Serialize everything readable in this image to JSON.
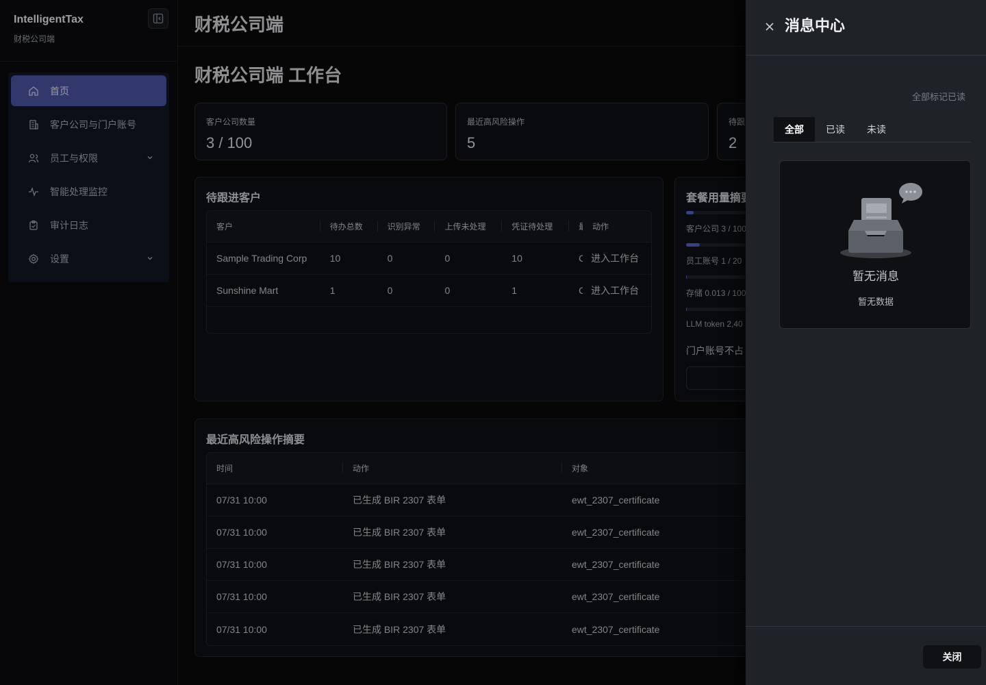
{
  "brand": {
    "title": "IntelligentTax",
    "subtitle": "财税公司端"
  },
  "nav": [
    {
      "label": "首页",
      "icon": "home-icon",
      "active": true
    },
    {
      "label": "客户公司与门户账号",
      "icon": "building-icon"
    },
    {
      "label": "员工与权限",
      "icon": "users-icon",
      "expandable": true
    },
    {
      "label": "智能处理监控",
      "icon": "activity-icon"
    },
    {
      "label": "审计日志",
      "icon": "clipboard-icon"
    },
    {
      "label": "设置",
      "icon": "gear-icon",
      "expandable": true
    }
  ],
  "header": {
    "title": "财税公司端"
  },
  "page": {
    "title": "财税公司端 工作台"
  },
  "stats": [
    {
      "label": "客户公司数量",
      "value": "3 / 100"
    },
    {
      "label": "最近高风险操作",
      "value": "5"
    },
    {
      "label": "待跟",
      "value": "2"
    }
  ],
  "pending": {
    "title": "待跟进客户",
    "columns": [
      "客户",
      "待办总数",
      "识别异常",
      "上传未处理",
      "凭证待处理",
      "最",
      "动作"
    ],
    "rows": [
      [
        "Sample Trading Corp",
        "10",
        "0",
        "0",
        "10",
        "C",
        "进入工作台"
      ],
      [
        "Sunshine Mart",
        "1",
        "0",
        "0",
        "1",
        "C",
        "进入工作台"
      ]
    ]
  },
  "usage": {
    "title": "套餐用量摘要",
    "items": [
      {
        "label": "客户公司 3 / 100",
        "fraction": 0.12
      },
      {
        "label": "员工账号 1 / 20",
        "fraction": 0.22
      },
      {
        "label": "存储 0.013 / 100",
        "fraction": 0.0
      },
      {
        "label": "LLM token 2,40",
        "fraction": 0.0
      }
    ],
    "note": "门户账号不占"
  },
  "risk": {
    "title": "最近高风险操作摘要",
    "columns": [
      "时间",
      "动作",
      "对象"
    ],
    "rows": [
      [
        "07/31 10:00",
        "已生成 BIR 2307 表单",
        "ewt_2307_certificate"
      ],
      [
        "07/31 10:00",
        "已生成 BIR 2307 表单",
        "ewt_2307_certificate"
      ],
      [
        "07/31 10:00",
        "已生成 BIR 2307 表单",
        "ewt_2307_certificate"
      ],
      [
        "07/31 10:00",
        "已生成 BIR 2307 表单",
        "ewt_2307_certificate"
      ],
      [
        "07/31 10:00",
        "已生成 BIR 2307 表单",
        "ewt_2307_certificate"
      ]
    ]
  },
  "drawer": {
    "title": "消息中心",
    "mark_all": "全部标记已读",
    "tabs": [
      "全部",
      "已读",
      "未读"
    ],
    "empty_title": "暂无消息",
    "empty_sub": "暂无数据",
    "close_label": "关闭"
  },
  "colors": {
    "accent": "#4e56a6",
    "bar": "#5661c9",
    "drawer_bg": "#1f2227"
  }
}
